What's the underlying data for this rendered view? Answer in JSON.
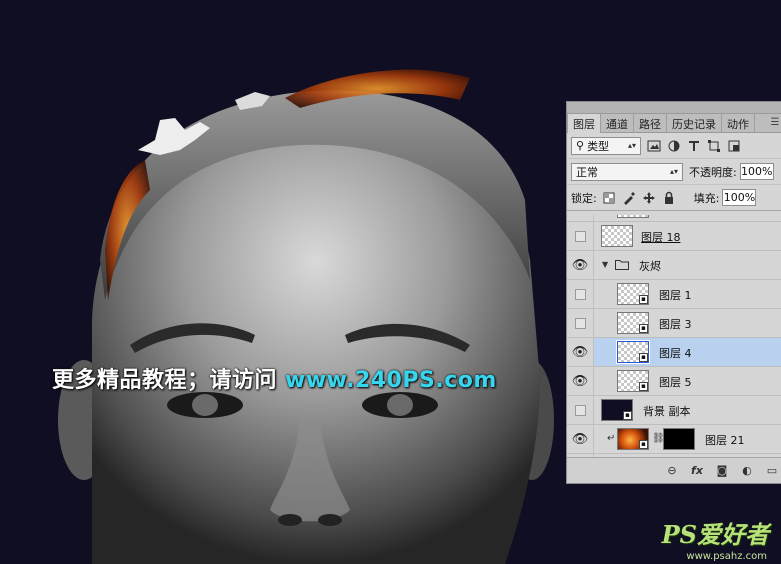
{
  "watermark": {
    "text": "更多精品教程；请访问",
    "url": "www.240PS.com"
  },
  "logo": {
    "text": "PS爱好者",
    "sub": "www.psahz.com"
  },
  "panel": {
    "tabs": [
      "图层",
      "通道",
      "路径",
      "历史记录",
      "动作"
    ],
    "active_tab": "图层",
    "menu_icon": "panel-menu-icon",
    "filter": {
      "kind": "类型",
      "search_icon": "search-icon"
    },
    "blend_mode": "正常",
    "opacity_label": "不透明度:",
    "opacity_value": "100%",
    "lock_label": "锁定:",
    "fill_label": "填充:",
    "fill_value": "100%",
    "layers": [
      {
        "name": "图层 18",
        "visible": false,
        "type": "layer",
        "underline": true
      },
      {
        "name": "灰烬",
        "visible": true,
        "type": "group"
      },
      {
        "name": "图层 1",
        "visible": false,
        "type": "smart"
      },
      {
        "name": "图层 3",
        "visible": false,
        "type": "smart"
      },
      {
        "name": "图层 4",
        "visible": true,
        "type": "smart",
        "selected": true
      },
      {
        "name": "图层 5",
        "visible": true,
        "type": "smart"
      },
      {
        "name": "背景 副本",
        "visible": false,
        "type": "smart-dark"
      },
      {
        "name": "图层 21",
        "visible": true,
        "type": "clipped-masked"
      }
    ],
    "bottom_icons": [
      "link-layers-icon",
      "fx-icon",
      "add-mask-icon",
      "adjustment-layer-icon",
      "new-group-icon"
    ],
    "fx_label": "fx"
  },
  "colors": {
    "canvas_bg": "#0f0e22",
    "panel_bg": "#d6d6d6",
    "selected_row": "#b9d1ee",
    "watermark_url": "#36d7ee"
  }
}
